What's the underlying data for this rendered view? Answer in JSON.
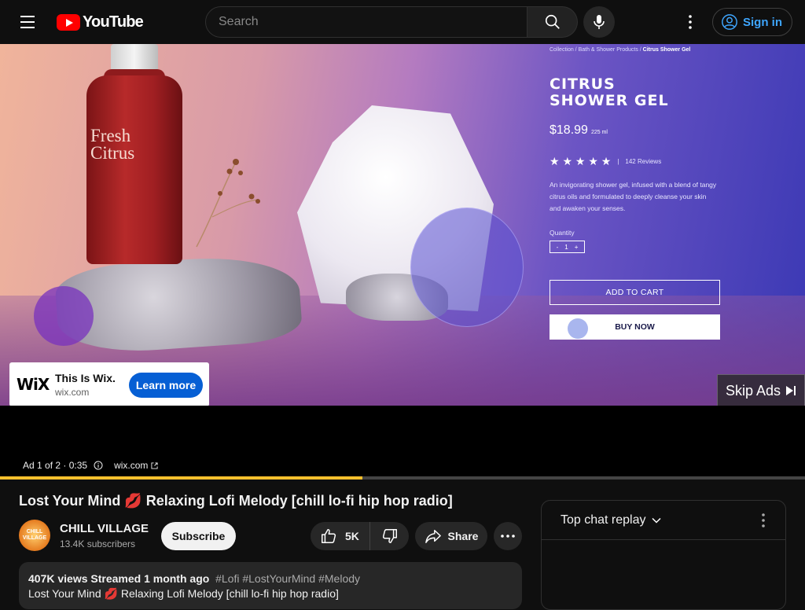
{
  "header": {
    "logo_text": "YouTube",
    "search_placeholder": "Search",
    "sign_in_label": "Sign in"
  },
  "ad_creative": {
    "breadcrumb_prefix": "Collection / Bath & Shower Products / ",
    "breadcrumb_current": "Citrus Shower Gel",
    "bottle_label": "Fresh Citrus",
    "product_title_line1": "CITRUS",
    "product_title_line2": "SHOWER GEL",
    "price": "$18.99",
    "volume": "225 ml",
    "stars": "★ ★ ★ ★ ★",
    "reviews": "142 Reviews",
    "description": "An invigorating shower gel, infused with a blend of tangy citrus oils and formulated to deeply cleanse your skin and awaken your senses.",
    "quantity_label": "Quantity",
    "quantity_value": "1",
    "add_to_cart_label": "ADD TO CART",
    "buy_now_label": "BUY NOW"
  },
  "ad_overlay": {
    "brand_logo": "WiX",
    "title": "This Is Wix.",
    "domain": "wix.com",
    "cta_label": "Learn more",
    "skip_label": "Skip Ads",
    "ad_counter": "Ad 1 of 2 · 0:35",
    "ad_link": "wix.com",
    "progress_fraction": 0.45,
    "progress_color": "#fbc02d"
  },
  "video": {
    "title": "Lost Your Mind 💋 Relaxing Lofi Melody [chill lo-fi hip hop radio]",
    "channel_name": "CHILL VILLAGE",
    "channel_avatar_text": "CHILL VILLAGE",
    "subscribers": "13.4K subscribers",
    "subscribe_label": "Subscribe",
    "likes": "5K",
    "share_label": "Share"
  },
  "description": {
    "meta": "407K views  Streamed 1 month ago",
    "tags": "#Lofi #LostYourMind #Melody",
    "first_line": "Lost Your Mind 💋 Relaxing Lofi Melody [chill lo-fi hip hop radio]"
  },
  "chat": {
    "header_label": "Top chat replay"
  }
}
